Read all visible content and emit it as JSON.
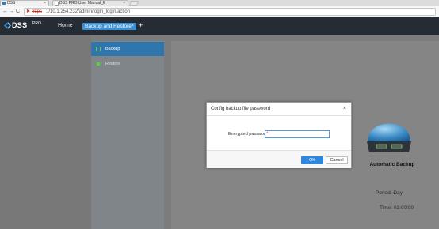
{
  "browser": {
    "tabs": [
      {
        "label": "DSS",
        "close": "×"
      },
      {
        "label": "DSS PRO User Manual_E",
        "close": "×"
      }
    ],
    "nav": {
      "back": "←",
      "forward": "→",
      "reload": "C"
    },
    "url": {
      "scheme": "https",
      "rest": "://10.1.254.232/admin/login_login.action"
    }
  },
  "app": {
    "brand": "DSS",
    "brand_sup": "PRO",
    "home": "Home",
    "active_tab": "Backup and Restore",
    "active_tab_close": "×",
    "add_tab": "+"
  },
  "sidebar": {
    "items": [
      {
        "label": "Backup"
      },
      {
        "label": "Restore"
      }
    ]
  },
  "main": {
    "title": "Automatic Backup",
    "period": "Period:  Day",
    "time": "Time:  03:00:00"
  },
  "dialog": {
    "title": "Config backup file password",
    "close": "×",
    "label": "Encrypted password:",
    "required": "*",
    "ok": "OK",
    "cancel": "Cancel"
  },
  "colors": {
    "header": "#262c33",
    "accent": "#3b8fd1",
    "ok_button": "#2e86de",
    "active_nav": "#2e76ab"
  }
}
